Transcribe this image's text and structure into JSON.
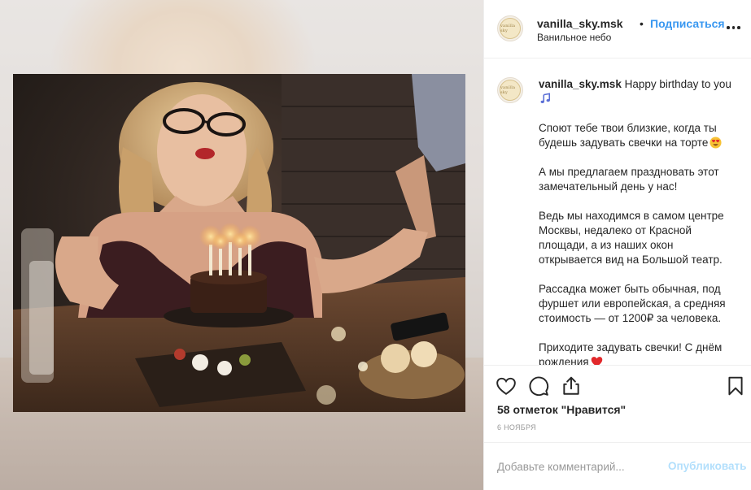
{
  "post": {
    "username": "vanilla_sky.msk",
    "separator": "•",
    "follow_label": "Подписаться",
    "location": "Ванильное небо",
    "avatar_text": "vanilla sky"
  },
  "caption": {
    "username": "vanilla_sky.msk",
    "first_line": "Happy birthday to you",
    "paragraphs": [
      "Споют тебе твои близкие, когда ты будешь задувать свечки на торте",
      "А мы предлагаем праздновать этот замечательный день у нас!",
      "Ведь мы находимся в самом центре Москвы, недалеко от Красной площади, а из наших окон открывается вид на Большой театр.",
      "Рассадка может быть обычная, под фуршет или европейская, а средняя стоимость — от 1200₽ за человека.",
      "Приходите задувать свечки! С днём рождения"
    ]
  },
  "icons": {
    "music": "musical-notes-emoji",
    "heart_eyes": "heart-eyes-emoji",
    "red_heart": "red-heart-emoji",
    "like": "heart-icon",
    "comment": "comment-icon",
    "share": "share-icon",
    "save": "bookmark-icon",
    "more": "more-dots-icon"
  },
  "stats": {
    "likes_label": "58 отметок \"Нравится\"",
    "date": "6 НОЯБРЯ"
  },
  "comment_box": {
    "placeholder": "Добавьте комментарий...",
    "publish_label": "Опубликовать"
  },
  "colors": {
    "link": "#3897f0",
    "publish_disabled": "#b2dffc",
    "text": "#262626",
    "muted": "#999999"
  }
}
